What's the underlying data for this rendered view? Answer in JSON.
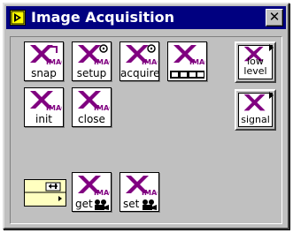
{
  "window": {
    "title": "Image Acquisition",
    "close_glyph": "✕"
  },
  "palette": {
    "items": [
      {
        "name": "snap-vi",
        "label": "snap",
        "icon": "imaq-logo-icon"
      },
      {
        "name": "setup-vi",
        "label": "setup",
        "icon": "imaq-setup-icon"
      },
      {
        "name": "acquire-vi",
        "label": "acquire",
        "icon": "imaq-acquire-icon"
      },
      {
        "name": "grab-vi",
        "label": "",
        "icon": "film-strip-icon"
      },
      {
        "name": "init-vi",
        "label": "init",
        "icon": "imaq-logo-icon"
      },
      {
        "name": "close-vi",
        "label": "close",
        "icon": "imaq-logo-icon"
      },
      {
        "name": "attribute-cluster",
        "label": "",
        "icon": "cluster-icon"
      },
      {
        "name": "get-vi",
        "label": "get",
        "icon": "camera-icon"
      },
      {
        "name": "set-vi",
        "label": "set",
        "icon": "camera-icon"
      }
    ],
    "subpalettes": [
      {
        "name": "low-level-subpalette",
        "label_line1": "low",
        "label_line2": "level",
        "icon": "submenu-arrow-icon"
      },
      {
        "name": "signal-subpalette",
        "label": "signal",
        "icon": "submenu-arrow-icon"
      }
    ],
    "logo_text": "IMAQ"
  },
  "colors": {
    "titlebar": "#000080",
    "face": "#c0c0c0",
    "ni_purple": "#800080",
    "cluster_yellow": "#ffffc0"
  }
}
